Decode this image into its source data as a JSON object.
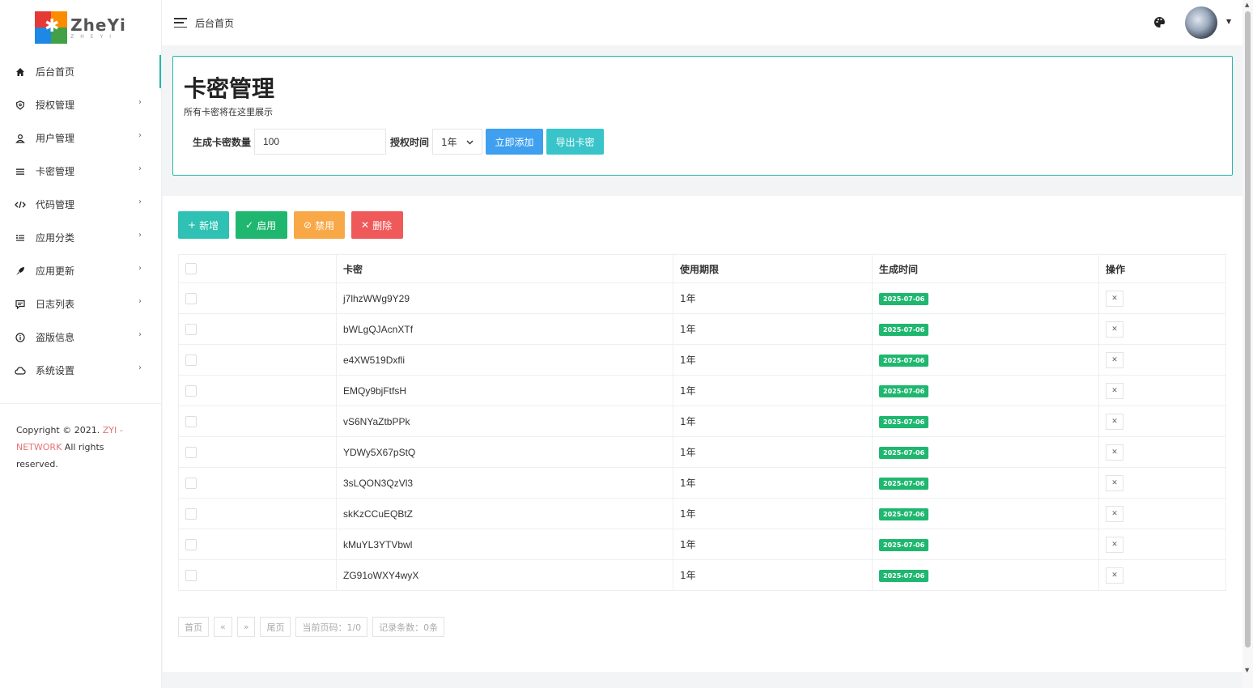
{
  "sidebar": {
    "logo_text": "ZheYi",
    "logo_sub": "ZHEYI",
    "items": [
      {
        "label": "后台首页",
        "icon": "home-icon"
      },
      {
        "label": "授权管理",
        "icon": "shield-icon"
      },
      {
        "label": "用户管理",
        "icon": "user-icon"
      },
      {
        "label": "卡密管理",
        "icon": "list-icon"
      },
      {
        "label": "代码管理",
        "icon": "code-icon"
      },
      {
        "label": "应用分类",
        "icon": "category-icon"
      },
      {
        "label": "应用更新",
        "icon": "rocket-icon"
      },
      {
        "label": "日志列表",
        "icon": "log-icon"
      },
      {
        "label": "盗版信息",
        "icon": "info-icon"
      },
      {
        "label": "系统设置",
        "icon": "cloud-icon"
      }
    ],
    "copyright_prefix": "Copyright © 2021.",
    "copyright_brand": "ZYI - NETWORK",
    "copyright_suffix": "All rights reserved."
  },
  "header": {
    "title": "后台首页"
  },
  "generator": {
    "title": "卡密管理",
    "subtitle": "所有卡密将在这里展示",
    "count_label": "生成卡密数量",
    "count_value": "100",
    "duration_label": "授权时间",
    "duration_value": "1年",
    "add_button": "立即添加",
    "export_button": "导出卡密"
  },
  "toolbar": {
    "add": "新增",
    "enable": "启用",
    "disable": "禁用",
    "delete": "删除"
  },
  "table": {
    "headers": [
      "卡密",
      "使用期限",
      "生成时间",
      "操作"
    ],
    "rows": [
      {
        "key": "j7lhzWWg9Y29",
        "period": "1年",
        "time": "2025-07-06"
      },
      {
        "key": "bWLgQJAcnXTf",
        "period": "1年",
        "time": "2025-07-06"
      },
      {
        "key": "e4XW519Dxfli",
        "period": "1年",
        "time": "2025-07-06"
      },
      {
        "key": "EMQy9bjFtfsH",
        "period": "1年",
        "time": "2025-07-06"
      },
      {
        "key": "vS6NYaZtbPPk",
        "period": "1年",
        "time": "2025-07-06"
      },
      {
        "key": "YDWy5X67pStQ",
        "period": "1年",
        "time": "2025-07-06"
      },
      {
        "key": "3sLQON3QzVl3",
        "period": "1年",
        "time": "2025-07-06"
      },
      {
        "key": "skKzCCuEQBtZ",
        "period": "1年",
        "time": "2025-07-06"
      },
      {
        "key": "kMuYL3YTVbwl",
        "period": "1年",
        "time": "2025-07-06"
      },
      {
        "key": "ZG91oWXY4wyX",
        "period": "1年",
        "time": "2025-07-06"
      }
    ]
  },
  "pager": {
    "first": "首页",
    "prev": "«",
    "next": "»",
    "last": "尾页",
    "current": "当前页码：1/0",
    "records": "记录条数：0条"
  }
}
